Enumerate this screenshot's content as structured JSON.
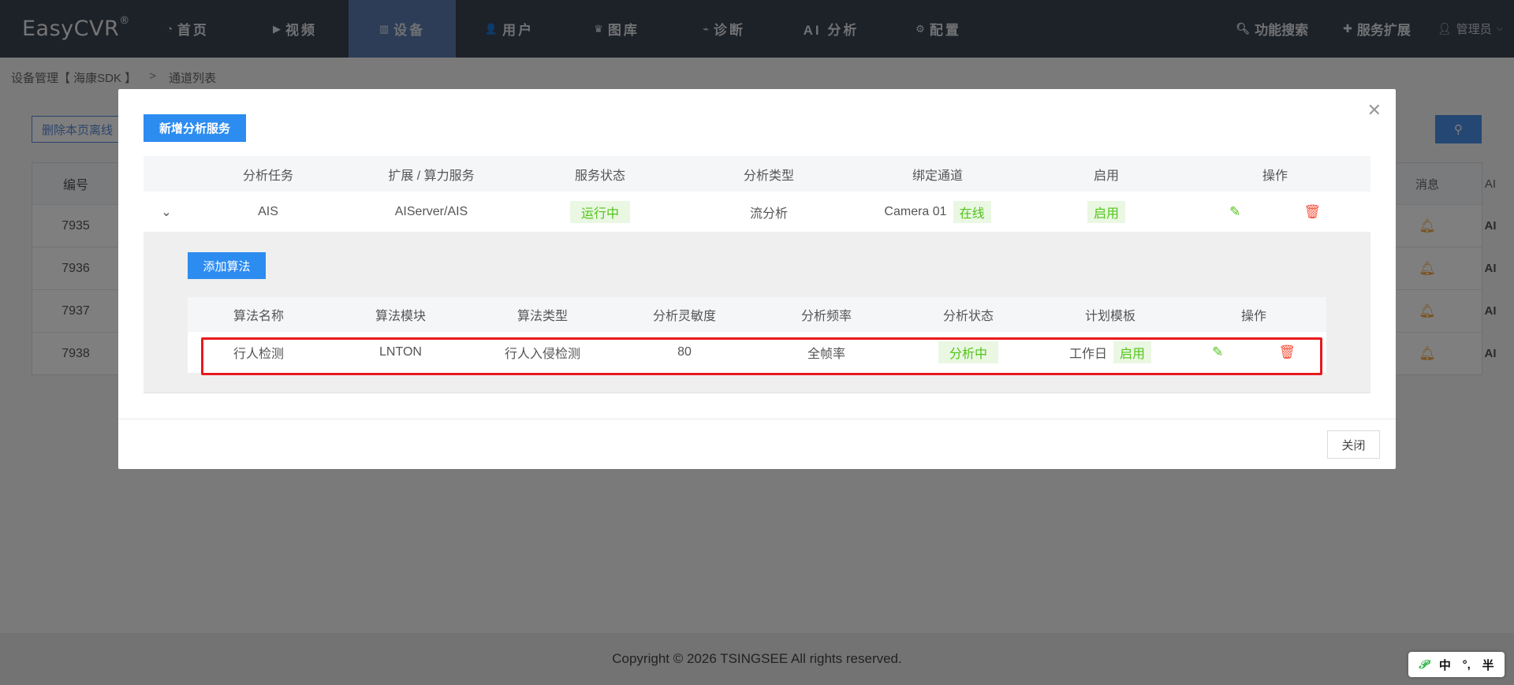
{
  "nav": {
    "logo": "EasyCVR",
    "logo_mark": "®",
    "items": [
      {
        "label": "首页",
        "icon": "dashboard-icon",
        "glyph": "◔"
      },
      {
        "label": "视频",
        "icon": "play-circle-icon",
        "glyph": "▶"
      },
      {
        "label": "设备",
        "icon": "device-icon",
        "glyph": "▥",
        "active": true
      },
      {
        "label": "用户",
        "icon": "user-icon",
        "glyph": "👤"
      },
      {
        "label": "图库",
        "icon": "gallery-icon",
        "glyph": "♛"
      },
      {
        "label": "诊断",
        "icon": "diagnose-icon",
        "glyph": "⌁"
      },
      {
        "label": "AI 分析",
        "icon": "",
        "glyph": ""
      },
      {
        "label": "配置",
        "icon": "gear-icon",
        "glyph": "⚙"
      }
    ],
    "feature_search": "功能搜索",
    "service_ext": "服务扩展",
    "user": "管理员"
  },
  "background": {
    "breadcrumb": [
      "设备管理【 海康SDK 】",
      ">",
      "通道列表"
    ],
    "delete_offline": "删除本页离线",
    "col_id": "编号",
    "col_msg": "消息",
    "col_ai": "AI",
    "ai_value": "AI",
    "rows": [
      "7935",
      "7936",
      "7937",
      "7938"
    ]
  },
  "modal": {
    "add_service": "新增分析服务",
    "service_columns": [
      "分析任务",
      "扩展 / 算力服务",
      "服务状态",
      "分析类型",
      "绑定通道",
      "启用",
      "操作"
    ],
    "service_row": {
      "task": "AIS",
      "service": "AIServer/AIS",
      "status": "运行中",
      "type": "流分析",
      "channel": "Camera 01",
      "channel_status": "在线",
      "enabled": "启用"
    },
    "add_algorithm": "添加算法",
    "algo_columns": [
      "算法名称",
      "算法模块",
      "算法类型",
      "分析灵敏度",
      "分析频率",
      "分析状态",
      "计划模板",
      "操作"
    ],
    "algo_row": {
      "name": "行人检测",
      "module": "LNTON",
      "type": "行人入侵检测",
      "sensitivity": "80",
      "frequency": "全帧率",
      "status": "分析中",
      "template": "工作日",
      "template_status": "启用"
    },
    "close": "关闭"
  },
  "footer": "Copyright © 2026 TSINGSEE All rights reserved.",
  "ime": [
    "中",
    "°,",
    "半"
  ],
  "colors": {
    "nav_bg": "#3a4250",
    "nav_active": "#5b7bb0",
    "primary": "#2d8cf0",
    "success": "#52c41a",
    "danger": "#f5523c",
    "highlight": "#e8191e"
  }
}
